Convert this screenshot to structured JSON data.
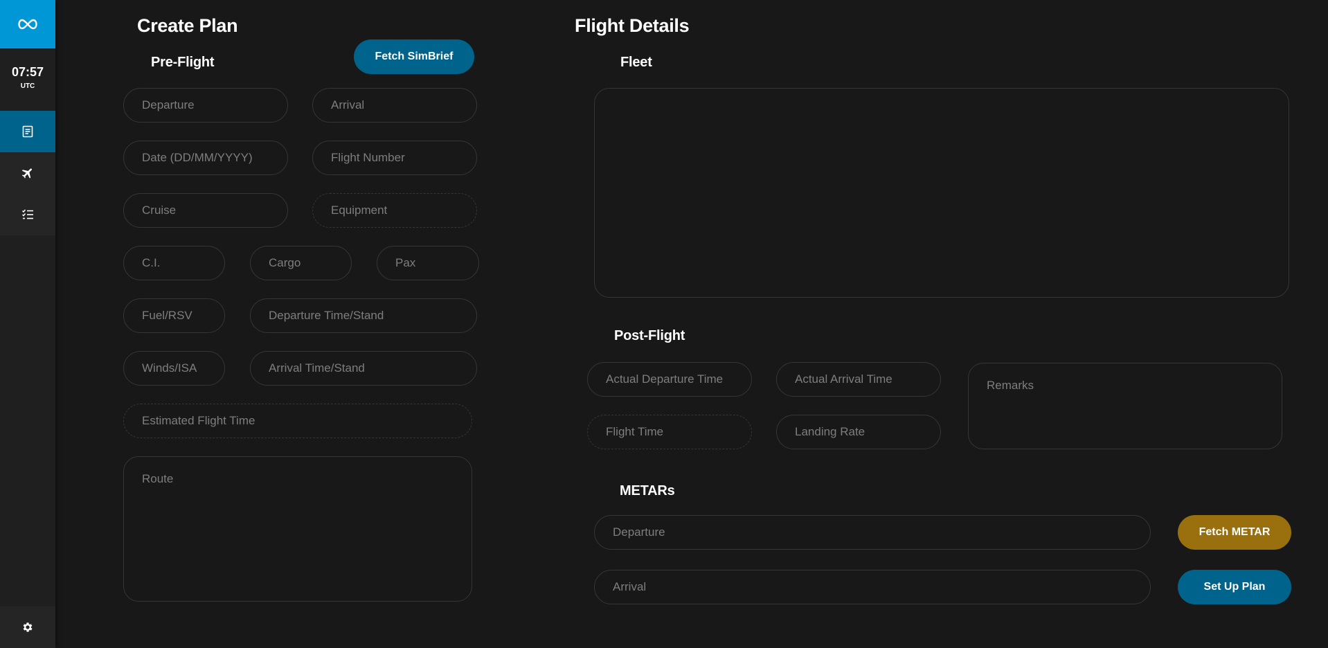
{
  "sidebar": {
    "time": "07:57",
    "timezone": "UTC"
  },
  "create_plan": {
    "title": "Create Plan",
    "preflight_title": "Pre-Flight",
    "fetch_simbrief_label": "Fetch SimBrief",
    "fields": {
      "departure": "Departure",
      "arrival": "Arrival",
      "date": "Date (DD/MM/YYYY)",
      "flight_number": "Flight Number",
      "cruise": "Cruise",
      "equipment": "Equipment",
      "ci": "C.I.",
      "cargo": "Cargo",
      "pax": "Pax",
      "fuel_rsv": "Fuel/RSV",
      "departure_time_stand": "Departure Time/Stand",
      "winds_isa": "Winds/ISA",
      "arrival_time_stand": "Arrival Time/Stand",
      "estimated_flight_time": "Estimated Flight Time",
      "route": "Route"
    }
  },
  "flight_details": {
    "title": "Flight Details",
    "fleet_title": "Fleet",
    "postflight_title": "Post-Flight",
    "postflight_fields": {
      "actual_departure_time": "Actual Departure Time",
      "actual_arrival_time": "Actual Arrival Time",
      "remarks": "Remarks",
      "flight_time": "Flight Time",
      "landing_rate": "Landing Rate"
    },
    "metars_title": "METARs",
    "metar_fields": {
      "departure": "Departure",
      "arrival": "Arrival"
    },
    "fetch_metar_label": "Fetch METAR",
    "set_up_plan_label": "Set Up Plan"
  },
  "colors": {
    "accent": "#0097d6",
    "button_blue": "#00638c",
    "button_gold": "#99700d",
    "background": "#181818"
  }
}
